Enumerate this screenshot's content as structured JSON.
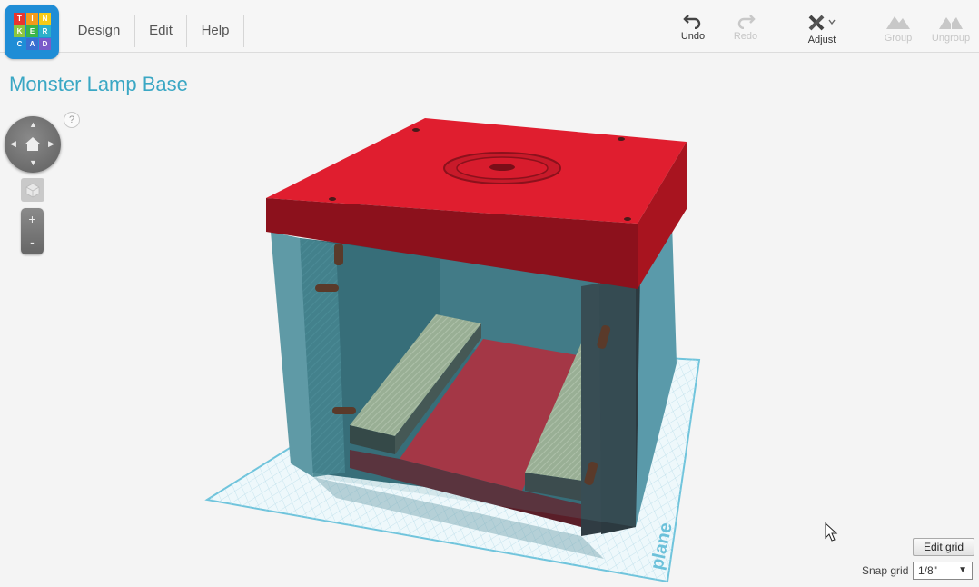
{
  "app": {
    "logo_letters": [
      "T",
      "I",
      "N",
      "K",
      "E",
      "R",
      "C",
      "A",
      "D"
    ]
  },
  "menu": {
    "items": [
      {
        "label": "Design"
      },
      {
        "label": "Edit"
      },
      {
        "label": "Help"
      }
    ]
  },
  "toolbar": {
    "undo_label": "Undo",
    "redo_label": "Redo",
    "adjust_label": "Adjust",
    "group_label": "Group",
    "ungroup_label": "Ungroup"
  },
  "project": {
    "title": "Monster Lamp Base"
  },
  "nav": {
    "help": "?",
    "zoom_in": "+",
    "zoom_out": "-"
  },
  "workplane": {
    "label": "Workplane"
  },
  "grid": {
    "edit_label": "Edit grid",
    "snap_label": "Snap grid",
    "snap_value": "1/8\""
  },
  "colors": {
    "accent": "#3aa7c4",
    "lid_red": "#e01e2f",
    "box_blue": "#4e9aa8",
    "logo_bg": "#1f8dd6"
  }
}
